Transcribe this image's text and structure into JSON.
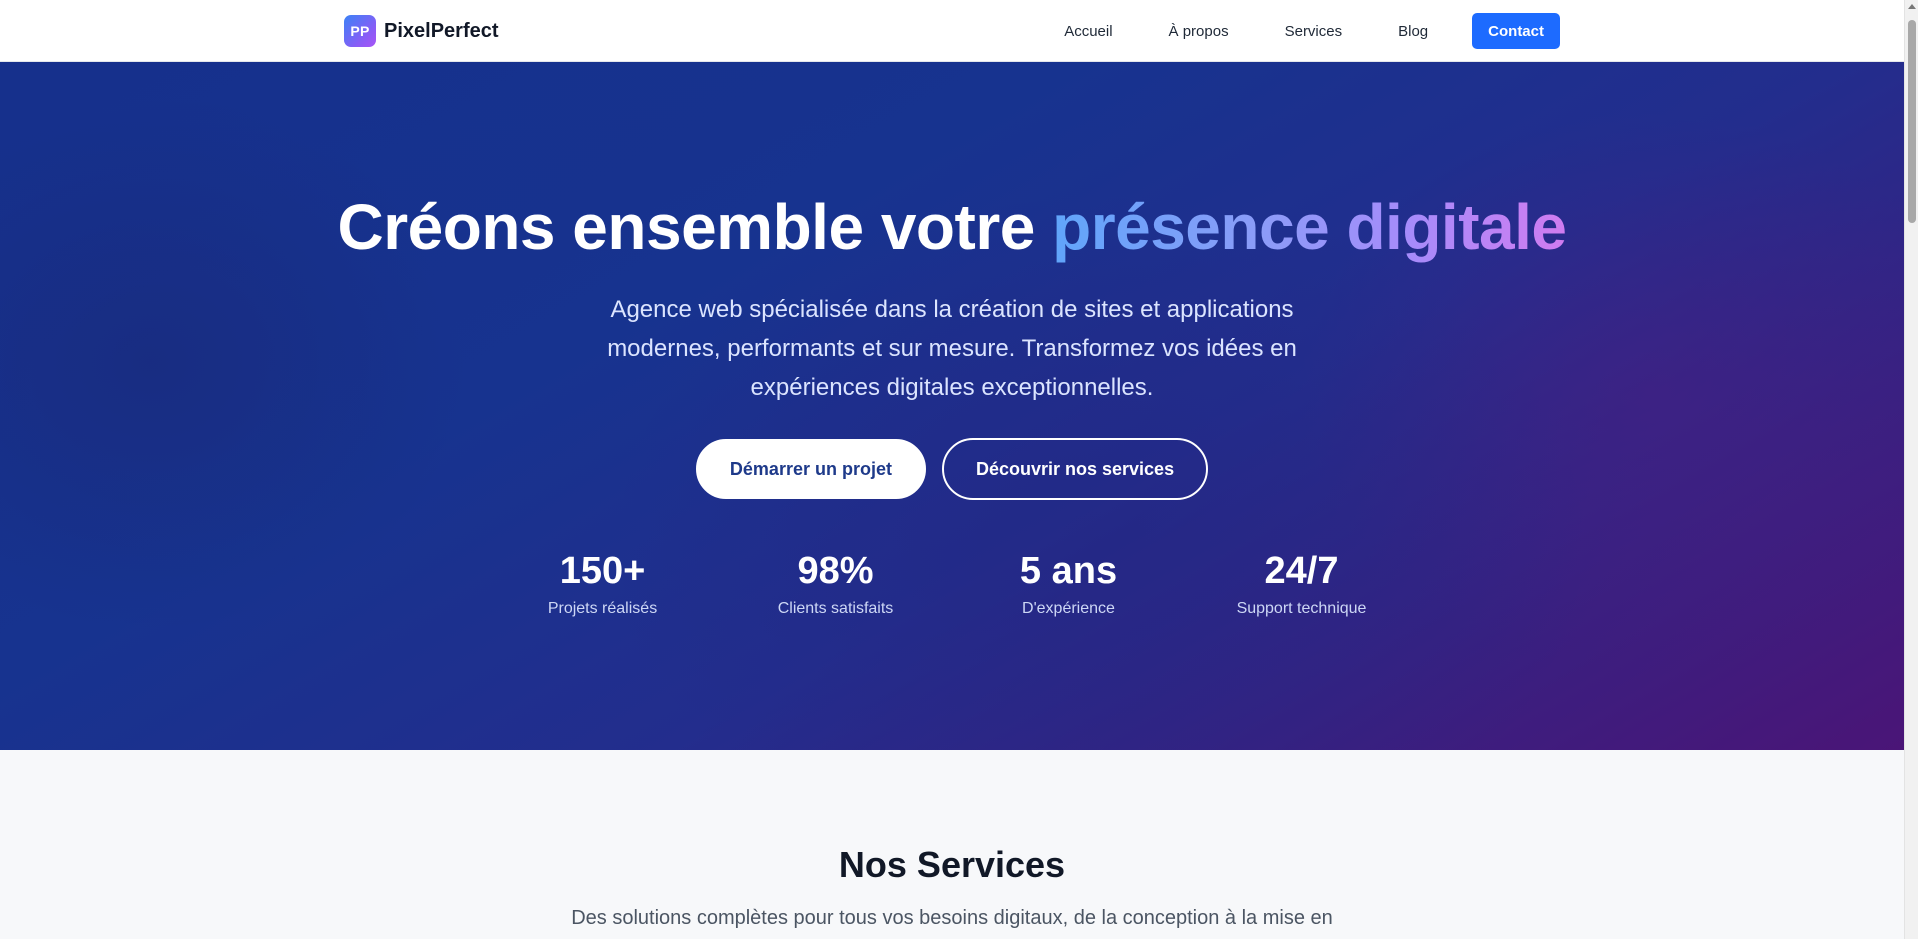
{
  "nav": {
    "logo_initials": "PP",
    "brand": "PixelPerfect",
    "links": [
      "Accueil",
      "À propos",
      "Services",
      "Blog"
    ],
    "cta": "Contact"
  },
  "hero": {
    "title_main": "Créons ensemble votre ",
    "title_accent": "présence digitale",
    "subtitle": "Agence web spécialisée dans la création de sites et applications modernes, performants et sur mesure. Transformez vos idées en expériences digitales exceptionnelles.",
    "primary_button": "Démarrer un projet",
    "secondary_button": "Découvrir nos services",
    "stats": [
      {
        "value": "150+",
        "label": "Projets réalisés"
      },
      {
        "value": "98%",
        "label": "Clients satisfaits"
      },
      {
        "value": "5 ans",
        "label": "D'expérience"
      },
      {
        "value": "24/7",
        "label": "Support technique"
      }
    ]
  },
  "services": {
    "title": "Nos Services",
    "subtitle": "Des solutions complètes pour tous vos besoins digitaux, de la conception à la mise en ligne."
  },
  "colors": {
    "cta_blue": "#1d6bff",
    "hero_start": "#16308c",
    "hero_end": "#4a1577"
  }
}
